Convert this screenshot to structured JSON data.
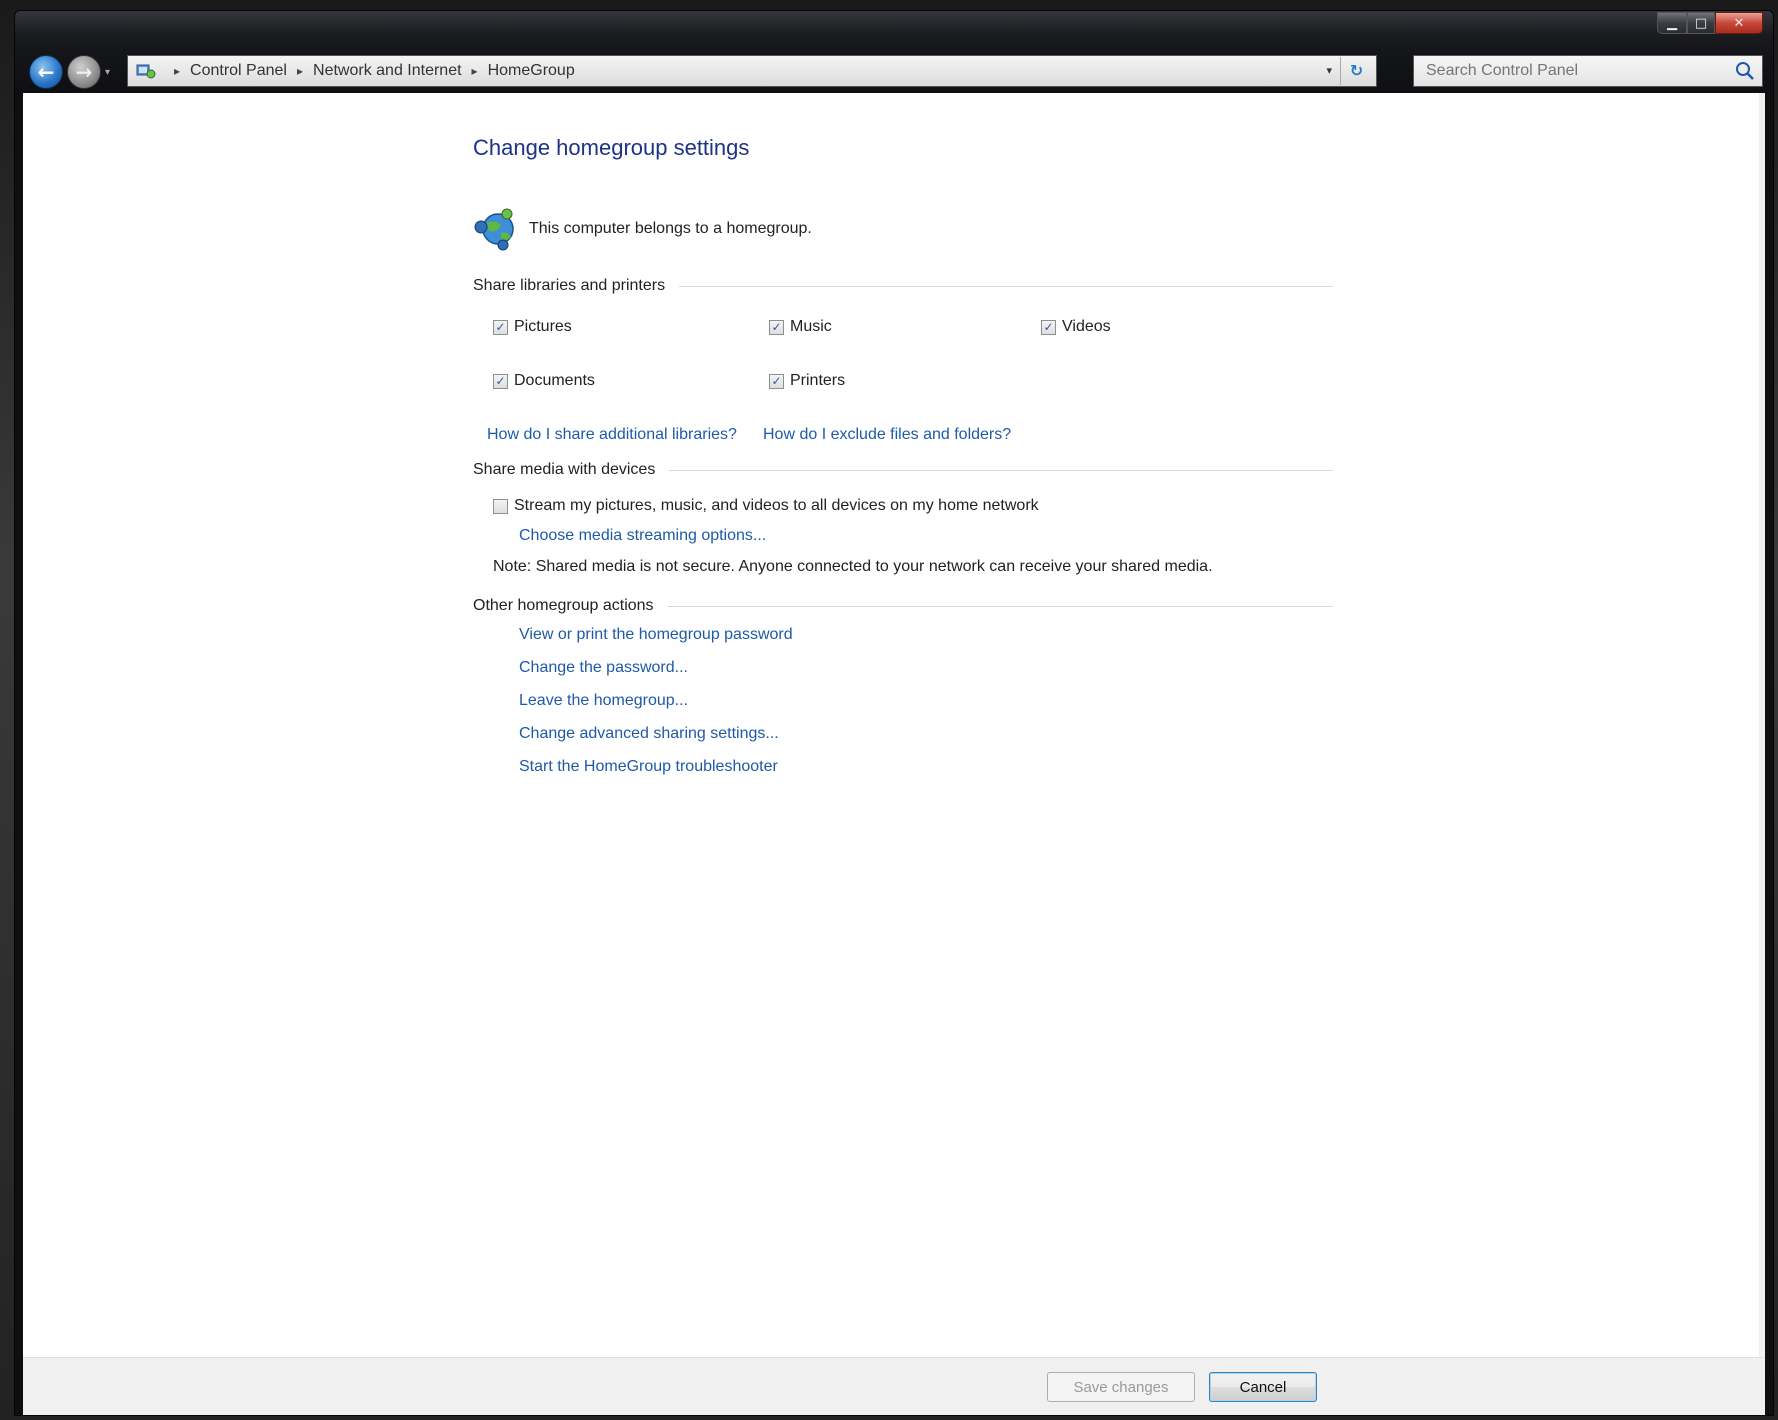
{
  "window": {
    "controls": {
      "minimize": "▁",
      "maximize": "□",
      "close": "✕"
    }
  },
  "navigation": {
    "back_glyph": "←",
    "forward_glyph": "→",
    "history_glyph": "▾",
    "breadcrumbs": [
      "Control Panel",
      "Network and Internet",
      "HomeGroup"
    ],
    "breadcrumb_separator": "▸",
    "dropdown_glyph": "▾",
    "refresh_glyph": "↻"
  },
  "search": {
    "placeholder": "Search Control Panel"
  },
  "page": {
    "title": "Change homegroup settings",
    "status": "This computer belongs to a homegroup.",
    "share_section": {
      "header": "Share libraries and printers",
      "items": [
        {
          "label": "Pictures",
          "checked": true
        },
        {
          "label": "Music",
          "checked": true
        },
        {
          "label": "Videos",
          "checked": true
        },
        {
          "label": "Documents",
          "checked": true
        },
        {
          "label": "Printers",
          "checked": true
        }
      ],
      "links": [
        "How do I share additional libraries?",
        "How do I exclude files and folders?"
      ]
    },
    "media_section": {
      "header": "Share media with devices",
      "stream_label": "Stream my pictures, music, and videos to all devices on my home network",
      "stream_checked": false,
      "options_link": "Choose media streaming options...",
      "note": "Note: Shared media is not secure. Anyone connected to your network can receive your shared media."
    },
    "other_section": {
      "header": "Other homegroup actions",
      "links": [
        "View or print the homegroup password",
        "Change the password...",
        "Leave the homegroup...",
        "Change advanced sharing settings...",
        "Start the HomeGroup troubleshooter"
      ]
    }
  },
  "footer": {
    "save_label": "Save changes",
    "cancel_label": "Cancel"
  },
  "colors": {
    "title": "#1e3287",
    "link": "#1e5aa8",
    "check_mark": "#3a5a9a"
  },
  "icons": {
    "homegroup": "homegroup-globe-icon",
    "search": "magnifier-icon",
    "address": "control-panel-icon"
  },
  "check_glyph": "✓"
}
